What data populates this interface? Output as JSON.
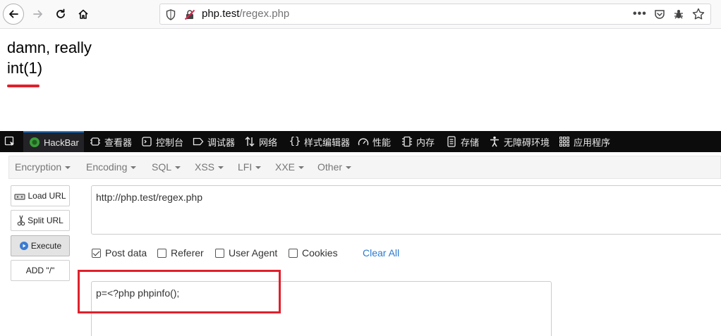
{
  "browser": {
    "url_host": "php.test",
    "url_path": "/regex.php",
    "more_label": "•••"
  },
  "page": {
    "line1": "damn, really",
    "line2": "int(1)"
  },
  "devtools": {
    "tabs": [
      "HackBar",
      "查看器",
      "控制台",
      "调试器",
      "网络",
      "样式编辑器",
      "性能",
      "内存",
      "存储",
      "无障碍环境",
      "应用程序"
    ]
  },
  "hackbar": {
    "menu": [
      "Encryption",
      "Encoding",
      "SQL",
      "XSS",
      "LFI",
      "XXE",
      "Other"
    ],
    "buttons": {
      "load_url": "Load URL",
      "split_url": "Split URL",
      "execute": "Execute",
      "add_slash": "ADD \"/\""
    },
    "url_value": "http://php.test/regex.php",
    "options": [
      {
        "label": "Post data",
        "checked": true
      },
      {
        "label": "Referer",
        "checked": false
      },
      {
        "label": "User Agent",
        "checked": false
      },
      {
        "label": "Cookies",
        "checked": false
      }
    ],
    "clear_all": "Clear All",
    "post_value": "p=<?php phpinfo();"
  },
  "colors": {
    "highlight_red": "#e0202c",
    "link_blue": "#2a7ad1",
    "devtools_bg": "#0c0c0d"
  }
}
